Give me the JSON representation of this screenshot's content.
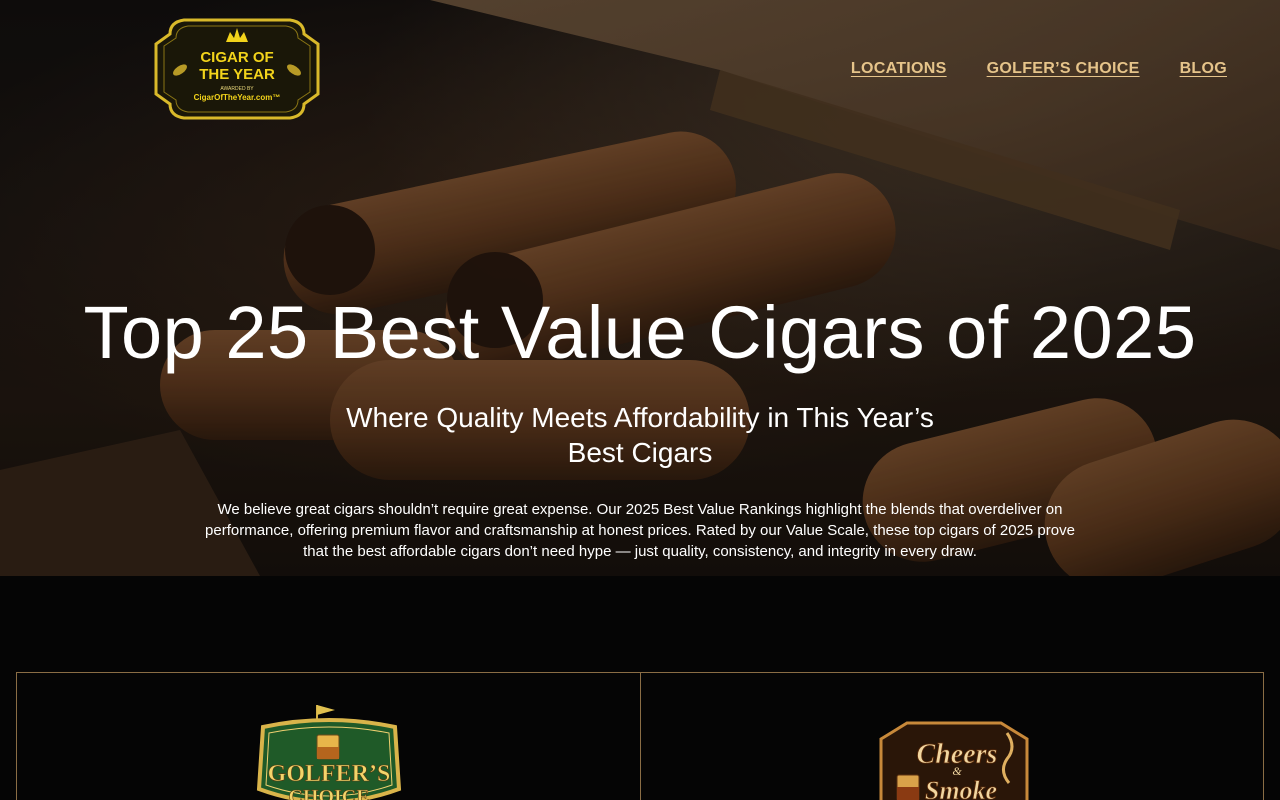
{
  "header": {
    "logo": {
      "line1": "CIGAR OF",
      "line2": "THE YEAR",
      "awarded": "AWARDED BY",
      "site": "CigarOfTheYear.com™",
      "icon": "crown-icon"
    },
    "nav": [
      {
        "label": "LOCATIONS"
      },
      {
        "label": "GOLFER’S CHOICE"
      },
      {
        "label": "BLOG"
      }
    ]
  },
  "hero": {
    "title": "Top 25 Best Value Cigars of 2025",
    "subtitle": "Where Quality Meets Affordability in This Year’s Best Cigars",
    "description": "We believe great cigars shouldn’t require great expense. Our 2025 Best Value Rankings highlight the blends that overdeliver on performance, offering premium flavor and craftsmanship at honest prices. Rated by our Value Scale, these top cigars of 2025 prove that the best affordable cigars don’t need hype — just quality, consistency, and integrity in every draw."
  },
  "cards": [
    {
      "logo_line1": "GOLFER’S",
      "logo_line2": "CHOICE",
      "icon": "golf-flag-icon"
    },
    {
      "logo_line1": "Cheers",
      "logo_amp": "&",
      "logo_line2": "Smoke",
      "icon": "whiskey-glass-icon"
    }
  ],
  "colors": {
    "accent_gold": "#e6c48a",
    "card_border": "#8a6d45",
    "logo_yellow": "#f2d31b",
    "page_bg": "#050505"
  }
}
